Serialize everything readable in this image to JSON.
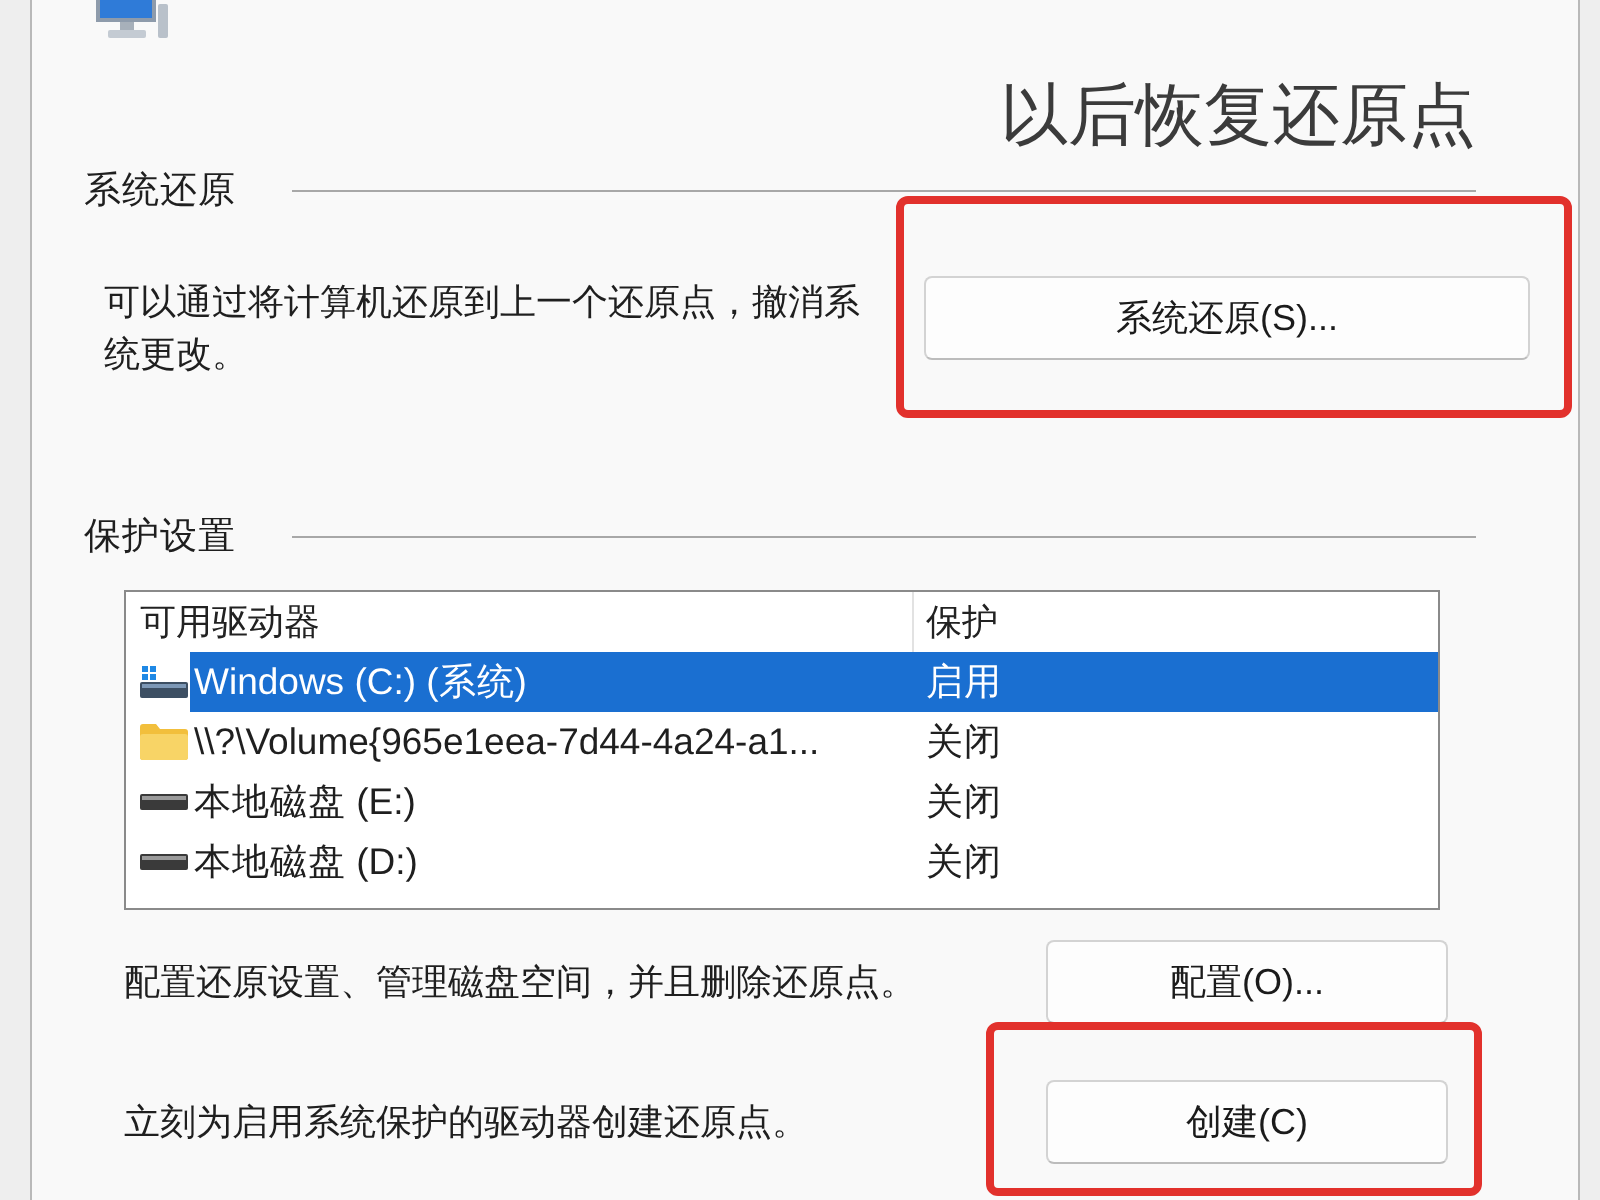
{
  "header": {
    "title": "以后恢复还原点"
  },
  "system_restore": {
    "heading": "系统还原",
    "description": "可以通过将计算机还原到上一个还原点，撤消系统更改。",
    "button": {
      "label": "系统还原(S)...",
      "highlighted": true
    }
  },
  "protection_settings": {
    "heading": "保护设置",
    "table": {
      "columns": [
        "可用驱动器",
        "保护"
      ],
      "rows": [
        {
          "kind": "system-drive",
          "drive": "Windows (C:) (系统)",
          "protection": "启用",
          "selected": true
        },
        {
          "kind": "folder",
          "drive": "\\\\?\\Volume{965e1eea-7d44-4a24-a1...",
          "protection": "关闭",
          "selected": false
        },
        {
          "kind": "drive",
          "drive": "本地磁盘 (E:)",
          "protection": "关闭",
          "selected": false
        },
        {
          "kind": "drive",
          "drive": "本地磁盘 (D:)",
          "protection": "关闭",
          "selected": false
        }
      ]
    }
  },
  "configure": {
    "description": "配置还原设置、管理磁盘空间，并且删除还原点。",
    "button": {
      "label": "配置(O)...",
      "highlighted": false
    }
  },
  "create": {
    "description": "立刻为启用系统保护的驱动器创建还原点。",
    "button": {
      "label": "创建(C)",
      "highlighted": true
    }
  }
}
